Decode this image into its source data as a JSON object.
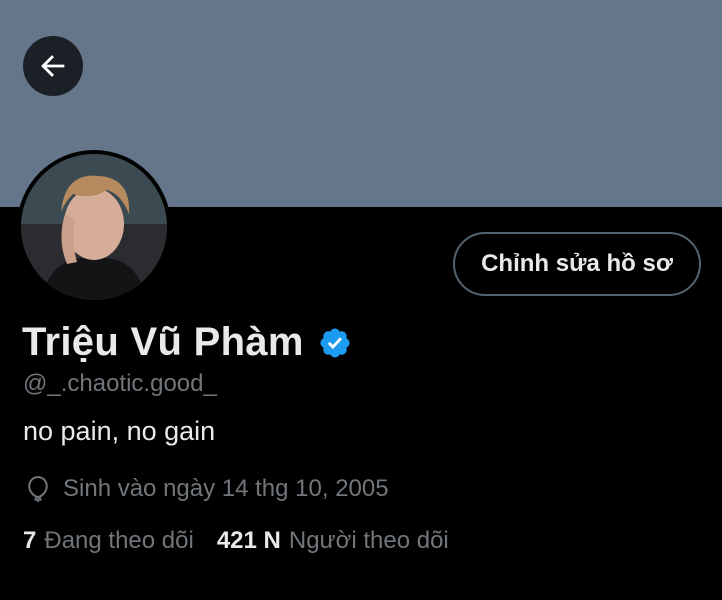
{
  "profile": {
    "display_name": "Triệu Vũ Phàm",
    "handle": "@_.chaotic.good_",
    "bio": "no pain, no gain",
    "birth": "Sinh vào ngày 14 thg 10, 2005",
    "verified_icon": "verified-badge-icon",
    "verified_color": "#1d9bf0"
  },
  "actions": {
    "edit_label": "Chỉnh sửa hồ sơ"
  },
  "stats": {
    "following_count": "7",
    "following_label": "Đang theo dõi",
    "followers_count": "421 N",
    "followers_label": "Người theo dõi"
  },
  "colors": {
    "banner": "#66768a",
    "background": "#000000",
    "secondary_text": "#71767b"
  }
}
